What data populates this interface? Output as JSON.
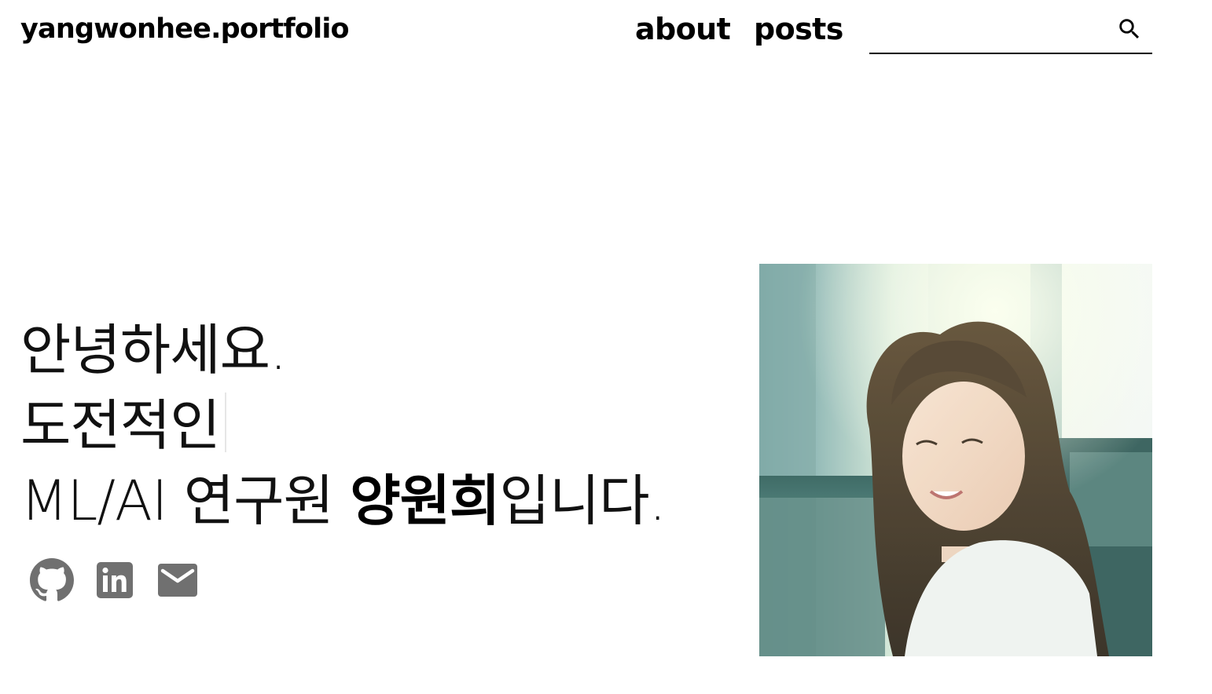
{
  "header": {
    "logo": "yangwonhee.portfolio",
    "nav": [
      {
        "label": "about"
      },
      {
        "label": "posts"
      }
    ],
    "search": {
      "value": "",
      "placeholder": ""
    }
  },
  "hero": {
    "line1": "안녕하세요.",
    "line2": "도전적인",
    "line3_prefix": "ML/AI 연구원 ",
    "line3_name": "양원희",
    "line3_suffix": "입니다."
  },
  "socials": [
    {
      "icon": "github-icon"
    },
    {
      "icon": "linkedin-icon"
    },
    {
      "icon": "mail-icon"
    }
  ],
  "colors": {
    "text": "#000000",
    "icon_gray": "#707070",
    "background": "#ffffff"
  }
}
